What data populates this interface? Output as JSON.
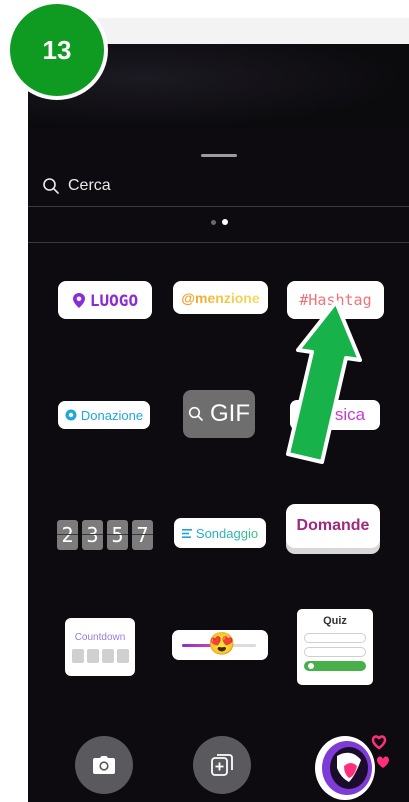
{
  "step_badge": "13",
  "search": {
    "label": "Cerca"
  },
  "pagination": {
    "pages": 2,
    "active": 2
  },
  "stickers": {
    "location": "LUOGO",
    "mention": "@menzione",
    "hashtag": "#Hashtag",
    "donation": "Donazione",
    "gif": "GIF",
    "music": "sica",
    "countdown_digits": [
      "2",
      "3",
      "5",
      "7"
    ],
    "poll": "Sondaggio",
    "questions": "Domande",
    "countdown_label": "Countdown",
    "quiz": "Quiz"
  },
  "icons": {
    "search": "search-icon",
    "location": "location-pin-icon",
    "donation": "donation-icon",
    "gif_search": "search-icon",
    "poll": "poll-lines-icon",
    "camera": "camera-icon",
    "add_media": "add-media-icon"
  },
  "colors": {
    "badge": "#0f9b22",
    "arrow": "#18b24a",
    "location_text": "#8b2bd6",
    "hashtag_text": "#f0737a",
    "questions_text": "#a0287f"
  }
}
